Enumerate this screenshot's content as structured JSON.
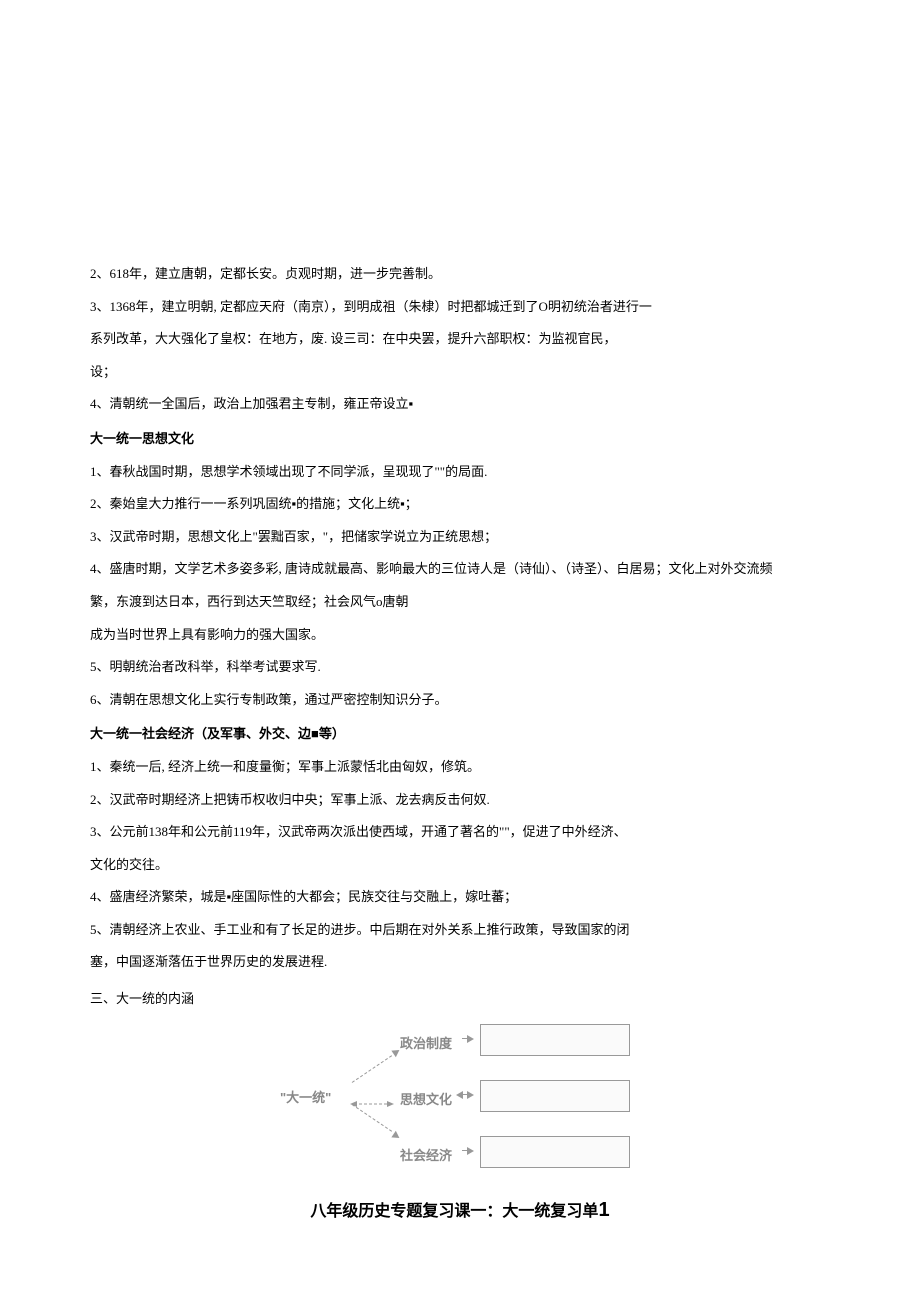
{
  "paras": {
    "p1": "2、618年，建立唐朝，定都长安。贞观时期，进一步完善制。",
    "p2": "3、1368年，建立明朝, 定都应天府（南京），到明成祖（朱棣）时把都城迁到了O明初统治者进行一",
    "p3": "系列改革，大大强化了皇权：在地方，废. 设三司：在中央罢，提升六部职权：为监视官民，",
    "p4": "设；",
    "p5": "4、清朝统一全国后，政治上加强君主专制，雍正帝设立▪"
  },
  "heading1": "大一统一思想文化",
  "sixiang": {
    "s1": "1、春秋战国时期，思想学术领域出现了不同学派，呈现现了\"\"的局面.",
    "s2": "2、秦始皇大力推行一一系列巩固统▪的措施；文化上统▪；",
    "s3": "3、汉武帝时期，思想文化上\"罢黜百家，\"，把储家学说立为正统思想；",
    "s4": "4、盛唐时期，文学艺术多姿多彩, 唐诗成就最高、影响最大的三位诗人是（诗仙）、（诗圣）、白居易；文化上对外交流频",
    "s5": "繁，东渡到达日本，西行到达天竺取经；社会风气o唐朝",
    "s6": "成为当时世界上具有影响力的强大国家。",
    "s7": "5、明朝统治者改科举，科举考试要求写.",
    "s8": "6、清朝在思想文化上实行专制政策，通过严密控制知识分子。"
  },
  "heading2": "大一统一社会经济（及军事、外交、边■等）",
  "jingji": {
    "j1": "1、秦统一后, 经济上统一和度量衡；军事上派蒙恬北由匈奴，修筑。",
    "j2": "2、汉武帝时期经济上把铸币权收归中央；军事上派、龙去病反击何奴.",
    "j3": "3、公元前138年和公元前119年，汉武帝两次派出使西域，开通了著名的\"\"，促进了中外经济、",
    "j4": "文化的交往。",
    "j5": "4、盛唐经济繁荣，城是▪座国际性的大都会；民族交往与交融上，嫁吐蕃；",
    "j6": "5、清朝经济上农业、手工业和有了长足的进步。中后期在对外关系上推行政策，导致国家的闭",
    "j7": "塞，中国逐渐落伍于世界历史的发展进程."
  },
  "section3": "三、大一统的内涵",
  "diagram": {
    "center": "\"大一统\"",
    "node1": "政治制度",
    "node2": "思想文化",
    "node3": "社会经济"
  },
  "bottom": {
    "prefix": "八年级历史专题复习课一：大一统复习单",
    "num": "1"
  }
}
